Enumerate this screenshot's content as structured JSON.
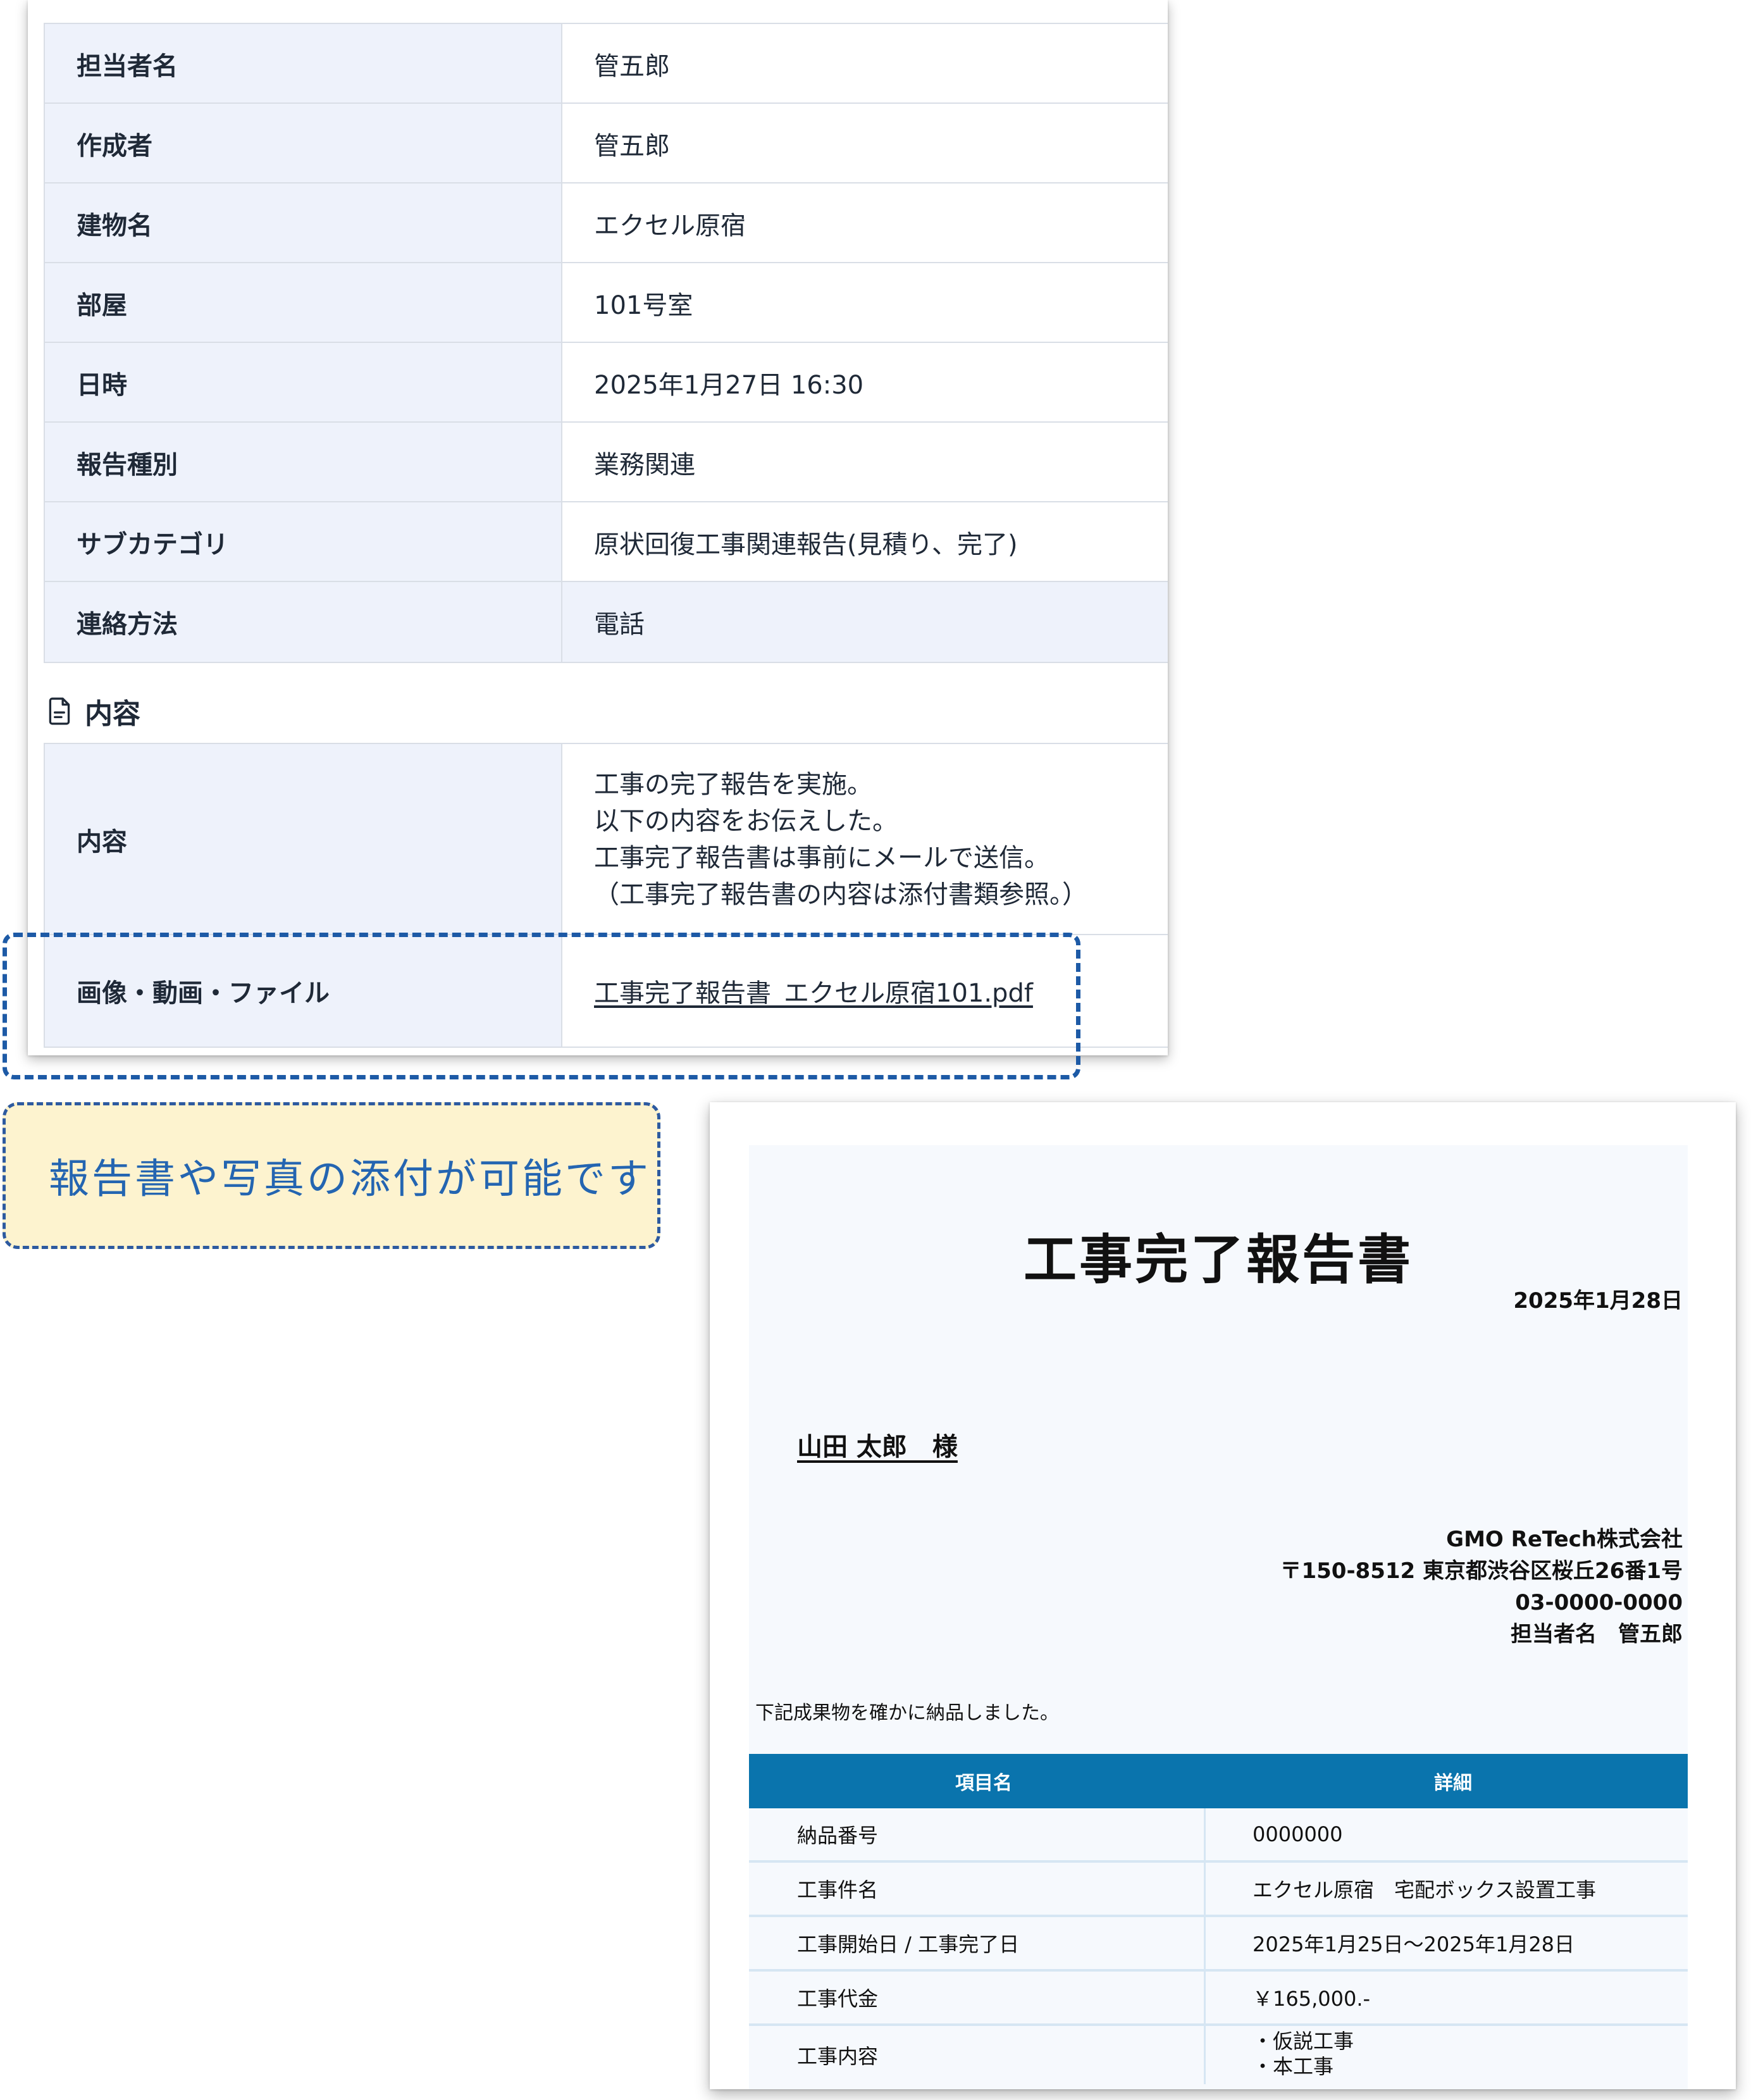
{
  "detail": {
    "rows": [
      {
        "label": "担当者名",
        "value": "管五郎"
      },
      {
        "label": "作成者",
        "value": "管五郎"
      },
      {
        "label": "建物名",
        "value": "エクセル原宿"
      },
      {
        "label": "部屋",
        "value": "101号室"
      },
      {
        "label": "日時",
        "value": "2025年1月27日 16:30"
      },
      {
        "label": "報告種別",
        "value": "業務関連"
      },
      {
        "label": "サブカテゴリ",
        "value": "原状回復工事関連報告(見積り、完了)"
      },
      {
        "label": "連絡方法",
        "value": "電話"
      }
    ],
    "section_title": "内容",
    "content_label": "内容",
    "content_lines": [
      "工事の完了報告を実施。",
      "以下の内容をお伝えした。",
      "工事完了報告書は事前にメールで送信。",
      "（工事完了報告書の内容は添付書類参照。）"
    ],
    "attachment_label": "画像・動画・ファイル",
    "attachment_link": "工事完了報告書_エクセル原宿101.pdf"
  },
  "callout": {
    "text": "報告書や写真の添付が可能です"
  },
  "report": {
    "title": "工事完了報告書",
    "date": "2025年1月28日",
    "addressee": "山田 太郎　様",
    "sender_lines": [
      "GMO ReTech株式会社",
      "〒150-8512 東京都渋谷区桜丘26番1号",
      "03-0000-0000",
      "担当者名　管五郎"
    ],
    "intro": "下記成果物を確かに納品しました。",
    "table": {
      "headers": [
        "項目名",
        "詳細"
      ],
      "rows": [
        {
          "item": "納品番号",
          "detail": "0000000"
        },
        {
          "item": "工事件名",
          "detail": "エクセル原宿　宅配ボックス設置工事"
        },
        {
          "item": "工事開始日 / 工事完了日",
          "detail": "2025年1月25日～2025年1月28日"
        },
        {
          "item": "工事代金",
          "detail": "￥165,000.-"
        }
      ],
      "work_content_label": "工事内容",
      "work_content_lines": [
        "・仮説工事",
        "・本工事"
      ]
    }
  },
  "colors": {
    "label_bg": "#eef2fb",
    "highlight_border": "#1d5aa6",
    "callout_bg": "#fdf3cf",
    "callout_text": "#2465b1",
    "table_header": "#0a74ad"
  }
}
